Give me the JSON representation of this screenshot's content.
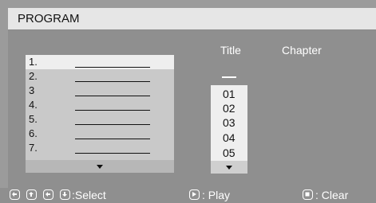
{
  "window": {
    "title": "PROGRAM"
  },
  "columns": {
    "title": "Title",
    "chapter": "Chapter"
  },
  "program_list": [
    "1.",
    "2.",
    "3",
    "4.",
    "5.",
    "6.",
    "7."
  ],
  "title_dash": "—",
  "title_list": [
    "01",
    "02",
    "03",
    "04",
    "05"
  ],
  "footer": {
    "select_label": ":Select",
    "play_label": ": Play",
    "clear_label": ": Clear"
  },
  "icons": [
    "left-arrow-icon",
    "up-arrow-icon",
    "left-arrow-icon",
    "down-arrow-icon",
    "play-icon",
    "stop-icon",
    "down-triangle-icon"
  ]
}
